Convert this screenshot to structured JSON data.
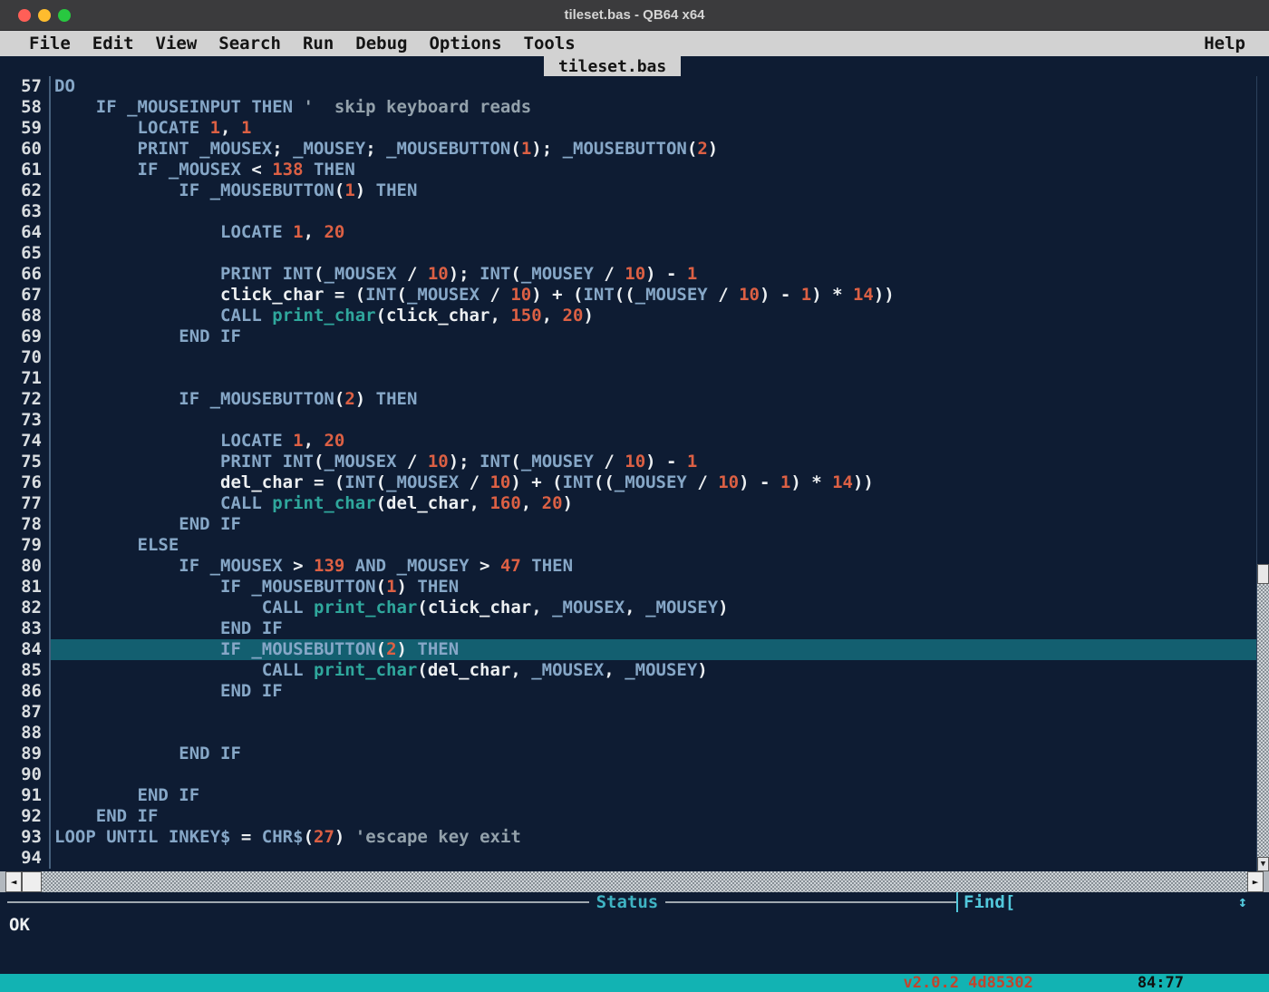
{
  "window": {
    "title": "tileset.bas - QB64 x64"
  },
  "menu": {
    "items": [
      "File",
      "Edit",
      "View",
      "Search",
      "Run",
      "Debug",
      "Options",
      "Tools"
    ],
    "right_items": [
      "Help"
    ]
  },
  "tab": {
    "label": "tileset.bas"
  },
  "editor": {
    "first_line": 57,
    "highlighted_line": 84,
    "lines": [
      {
        "n": 57,
        "t": [
          [
            "k",
            "DO"
          ]
        ]
      },
      {
        "n": 58,
        "t": [
          [
            "k",
            "    IF _MOUSEINPUT THEN "
          ],
          [
            "c",
            "'  skip keyboard reads"
          ]
        ]
      },
      {
        "n": 59,
        "t": [
          [
            "k",
            "        LOCATE "
          ],
          [
            "n",
            "1"
          ],
          [
            "p",
            ", "
          ],
          [
            "n",
            "1"
          ]
        ]
      },
      {
        "n": 60,
        "t": [
          [
            "k",
            "        PRINT _MOUSEX"
          ],
          [
            "p",
            "; "
          ],
          [
            "k",
            "_MOUSEY"
          ],
          [
            "p",
            "; "
          ],
          [
            "k",
            "_MOUSEBUTTON"
          ],
          [
            "p",
            "("
          ],
          [
            "n",
            "1"
          ],
          [
            "p",
            "); "
          ],
          [
            "k",
            "_MOUSEBUTTON"
          ],
          [
            "p",
            "("
          ],
          [
            "n",
            "2"
          ],
          [
            "p",
            ")"
          ]
        ]
      },
      {
        "n": 61,
        "t": [
          [
            "k",
            "        IF _MOUSEX "
          ],
          [
            "p",
            "< "
          ],
          [
            "n",
            "138"
          ],
          [
            "k",
            " THEN"
          ]
        ]
      },
      {
        "n": 62,
        "t": [
          [
            "k",
            "            IF _MOUSEBUTTON"
          ],
          [
            "p",
            "("
          ],
          [
            "n",
            "1"
          ],
          [
            "p",
            ") "
          ],
          [
            "k",
            "THEN"
          ]
        ]
      },
      {
        "n": 63,
        "t": []
      },
      {
        "n": 64,
        "t": [
          [
            "k",
            "                LOCATE "
          ],
          [
            "n",
            "1"
          ],
          [
            "p",
            ", "
          ],
          [
            "n",
            "20"
          ]
        ]
      },
      {
        "n": 65,
        "t": []
      },
      {
        "n": 66,
        "t": [
          [
            "k",
            "                PRINT INT"
          ],
          [
            "p",
            "("
          ],
          [
            "k",
            "_MOUSEX"
          ],
          [
            "p",
            " / "
          ],
          [
            "n",
            "10"
          ],
          [
            "p",
            "); "
          ],
          [
            "k",
            "INT"
          ],
          [
            "p",
            "("
          ],
          [
            "k",
            "_MOUSEY"
          ],
          [
            "p",
            " / "
          ],
          [
            "n",
            "10"
          ],
          [
            "p",
            ") - "
          ],
          [
            "n",
            "1"
          ]
        ]
      },
      {
        "n": 67,
        "t": [
          [
            "p",
            "                click_char = ("
          ],
          [
            "k",
            "INT"
          ],
          [
            "p",
            "("
          ],
          [
            "k",
            "_MOUSEX"
          ],
          [
            "p",
            " / "
          ],
          [
            "n",
            "10"
          ],
          [
            "p",
            ") + ("
          ],
          [
            "k",
            "INT"
          ],
          [
            "p",
            "(("
          ],
          [
            "k",
            "_MOUSEY"
          ],
          [
            "p",
            " / "
          ],
          [
            "n",
            "10"
          ],
          [
            "p",
            ") - "
          ],
          [
            "n",
            "1"
          ],
          [
            "p",
            ") * "
          ],
          [
            "n",
            "14"
          ],
          [
            "p",
            "))"
          ]
        ]
      },
      {
        "n": 68,
        "t": [
          [
            "k",
            "                CALL "
          ],
          [
            "s",
            "print_char"
          ],
          [
            "p",
            "(click_char, "
          ],
          [
            "n",
            "150"
          ],
          [
            "p",
            ", "
          ],
          [
            "n",
            "20"
          ],
          [
            "p",
            ")"
          ]
        ]
      },
      {
        "n": 69,
        "t": [
          [
            "k",
            "            END IF"
          ]
        ]
      },
      {
        "n": 70,
        "t": []
      },
      {
        "n": 71,
        "t": []
      },
      {
        "n": 72,
        "t": [
          [
            "k",
            "            IF _MOUSEBUTTON"
          ],
          [
            "p",
            "("
          ],
          [
            "n",
            "2"
          ],
          [
            "p",
            ") "
          ],
          [
            "k",
            "THEN"
          ]
        ]
      },
      {
        "n": 73,
        "t": []
      },
      {
        "n": 74,
        "t": [
          [
            "k",
            "                LOCATE "
          ],
          [
            "n",
            "1"
          ],
          [
            "p",
            ", "
          ],
          [
            "n",
            "20"
          ]
        ]
      },
      {
        "n": 75,
        "t": [
          [
            "k",
            "                PRINT INT"
          ],
          [
            "p",
            "("
          ],
          [
            "k",
            "_MOUSEX"
          ],
          [
            "p",
            " / "
          ],
          [
            "n",
            "10"
          ],
          [
            "p",
            "); "
          ],
          [
            "k",
            "INT"
          ],
          [
            "p",
            "("
          ],
          [
            "k",
            "_MOUSEY"
          ],
          [
            "p",
            " / "
          ],
          [
            "n",
            "10"
          ],
          [
            "p",
            ") - "
          ],
          [
            "n",
            "1"
          ]
        ]
      },
      {
        "n": 76,
        "t": [
          [
            "p",
            "                del_char = ("
          ],
          [
            "k",
            "INT"
          ],
          [
            "p",
            "("
          ],
          [
            "k",
            "_MOUSEX"
          ],
          [
            "p",
            " / "
          ],
          [
            "n",
            "10"
          ],
          [
            "p",
            ") + ("
          ],
          [
            "k",
            "INT"
          ],
          [
            "p",
            "(("
          ],
          [
            "k",
            "_MOUSEY"
          ],
          [
            "p",
            " / "
          ],
          [
            "n",
            "10"
          ],
          [
            "p",
            ") - "
          ],
          [
            "n",
            "1"
          ],
          [
            "p",
            ") * "
          ],
          [
            "n",
            "14"
          ],
          [
            "p",
            "))"
          ]
        ]
      },
      {
        "n": 77,
        "t": [
          [
            "k",
            "                CALL "
          ],
          [
            "s",
            "print_char"
          ],
          [
            "p",
            "(del_char, "
          ],
          [
            "n",
            "160"
          ],
          [
            "p",
            ", "
          ],
          [
            "n",
            "20"
          ],
          [
            "p",
            ")"
          ]
        ]
      },
      {
        "n": 78,
        "t": [
          [
            "k",
            "            END IF"
          ]
        ]
      },
      {
        "n": 79,
        "t": [
          [
            "k",
            "        ELSE"
          ]
        ]
      },
      {
        "n": 80,
        "t": [
          [
            "k",
            "            IF _MOUSEX "
          ],
          [
            "p",
            "> "
          ],
          [
            "n",
            "139"
          ],
          [
            "k",
            " AND _MOUSEY "
          ],
          [
            "p",
            "> "
          ],
          [
            "n",
            "47"
          ],
          [
            "k",
            " THEN"
          ]
        ]
      },
      {
        "n": 81,
        "t": [
          [
            "k",
            "                IF _MOUSEBUTTON"
          ],
          [
            "p",
            "("
          ],
          [
            "n",
            "1"
          ],
          [
            "p",
            ") "
          ],
          [
            "k",
            "THEN"
          ]
        ]
      },
      {
        "n": 82,
        "t": [
          [
            "k",
            "                    CALL "
          ],
          [
            "s",
            "print_char"
          ],
          [
            "p",
            "(click_char, "
          ],
          [
            "k",
            "_MOUSEX"
          ],
          [
            "p",
            ", "
          ],
          [
            "k",
            "_MOUSEY"
          ],
          [
            "p",
            ")"
          ]
        ]
      },
      {
        "n": 83,
        "t": [
          [
            "k",
            "                END IF"
          ]
        ]
      },
      {
        "n": 84,
        "t": [
          [
            "k",
            "                IF _MOUSEBUTTON"
          ],
          [
            "p",
            "("
          ],
          [
            "n",
            "2"
          ],
          [
            "p",
            ") "
          ],
          [
            "k",
            "THEN"
          ]
        ]
      },
      {
        "n": 85,
        "t": [
          [
            "k",
            "                    CALL "
          ],
          [
            "s",
            "print_char"
          ],
          [
            "p",
            "(del_char, "
          ],
          [
            "k",
            "_MOUSEX"
          ],
          [
            "p",
            ", "
          ],
          [
            "k",
            "_MOUSEY"
          ],
          [
            "p",
            ")"
          ]
        ]
      },
      {
        "n": 86,
        "t": [
          [
            "k",
            "                END IF"
          ]
        ]
      },
      {
        "n": 87,
        "t": []
      },
      {
        "n": 88,
        "t": []
      },
      {
        "n": 89,
        "t": [
          [
            "k",
            "            END IF"
          ]
        ]
      },
      {
        "n": 90,
        "t": []
      },
      {
        "n": 91,
        "t": [
          [
            "k",
            "        END IF"
          ]
        ]
      },
      {
        "n": 92,
        "t": [
          [
            "k",
            "    END IF"
          ]
        ]
      },
      {
        "n": 93,
        "t": [
          [
            "k",
            "LOOP UNTIL INKEY$ "
          ],
          [
            "p",
            "= "
          ],
          [
            "k",
            "CHR$"
          ],
          [
            "p",
            "("
          ],
          [
            "n",
            "27"
          ],
          [
            "p",
            ") "
          ],
          [
            "c",
            "'escape key exit"
          ]
        ]
      },
      {
        "n": 94,
        "t": []
      }
    ]
  },
  "status": {
    "panel_title": "Status",
    "find_label": "Find[",
    "message": "OK"
  },
  "bottombar": {
    "version": "v2.0.2 4d85302",
    "cursor_position": "84:77"
  },
  "icons": {
    "hscroll_left": "◄",
    "hscroll_right": "►",
    "vscroll_down": "▼",
    "resize_updown": "↕"
  },
  "colors": {
    "editor_bg": "#0e1c33",
    "keyword": "#86a7c7",
    "number": "#dc6044",
    "plain": "#eceff1",
    "subname": "#2fa79c",
    "comment": "#93a1ab",
    "highlight": "#135f70",
    "linenumber": "#d9dde0",
    "status_label": "#3fb3c3",
    "find_cyan": "#52c8dc",
    "statusbar_teal": "#12b3b3",
    "version_red": "#c2442c"
  }
}
